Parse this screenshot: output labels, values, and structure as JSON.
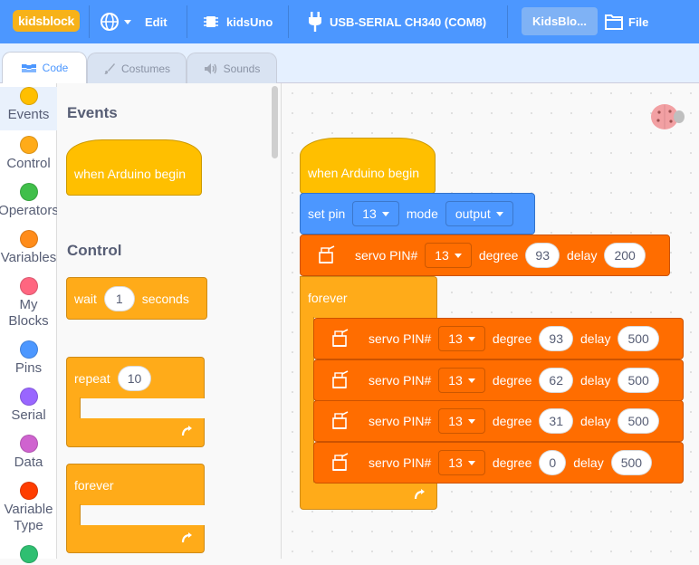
{
  "menubar": {
    "logo": "kidsblock",
    "edit": "Edit",
    "board": "kidsUno",
    "port": "USB-SERIAL CH340 (COM8)",
    "project": "KidsBlo...",
    "file": "File"
  },
  "tabs": {
    "code": "Code",
    "costumes": "Costumes",
    "sounds": "Sounds"
  },
  "categories": [
    {
      "label": "Events",
      "color": "#ffbf00"
    },
    {
      "label": "Control",
      "color": "#ffab19"
    },
    {
      "label": "Operators",
      "color": "#40bf4a"
    },
    {
      "label": "Variables",
      "color": "#ff8c1a"
    },
    {
      "label": "My Blocks",
      "color": "#ff6680"
    },
    {
      "label": "Pins",
      "color": "#4c97ff"
    },
    {
      "label": "Serial",
      "color": "#9966ff"
    },
    {
      "label": "Data",
      "color": "#cf63cf"
    },
    {
      "label": "Variable Type",
      "color": "#ff3d00"
    },
    {
      "label": "",
      "color": "#2fbf71"
    }
  ],
  "palette": {
    "events_title": "Events",
    "control_title": "Control",
    "when_begin": "when Arduino begin",
    "wait": "wait",
    "wait_value": "1",
    "seconds": "seconds",
    "repeat": "repeat",
    "repeat_value": "10",
    "forever": "forever"
  },
  "script": {
    "hat": "when Arduino begin",
    "setpin": {
      "label": "set pin",
      "pin": "13",
      "mode_label": "mode",
      "mode": "output"
    },
    "servo_top": {
      "label": "servo PIN#",
      "pin": "13",
      "degree_label": "degree",
      "degree": "93",
      "delay_label": "delay",
      "delay": "200"
    },
    "forever": "forever",
    "loop": [
      {
        "label": "servo PIN#",
        "pin": "13",
        "degree_label": "degree",
        "degree": "93",
        "delay_label": "delay",
        "delay": "500"
      },
      {
        "label": "servo PIN#",
        "pin": "13",
        "degree_label": "degree",
        "degree": "62",
        "delay_label": "delay",
        "delay": "500"
      },
      {
        "label": "servo PIN#",
        "pin": "13",
        "degree_label": "degree",
        "degree": "31",
        "delay_label": "delay",
        "delay": "500"
      },
      {
        "label": "servo PIN#",
        "pin": "13",
        "degree_label": "degree",
        "degree": "0",
        "delay_label": "delay",
        "delay": "500"
      }
    ]
  }
}
